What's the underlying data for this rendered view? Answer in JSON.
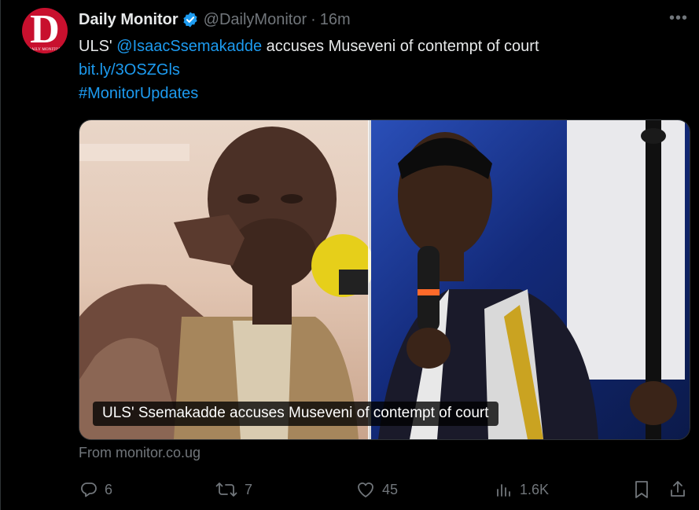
{
  "account": {
    "name": "Daily Monitor",
    "handle": "@DailyMonitor",
    "separator": "·",
    "time": "16m",
    "avatar_logo_letter": "D",
    "avatar_logo_sub": "DAILY MONITOR"
  },
  "more_icon": "…",
  "tweet": {
    "prefix": "ULS' ",
    "mention": "@IsaacSsemakadde",
    "rest": " accuses Museveni of contempt of court",
    "short_link": "bit.ly/3OSZGls",
    "hashtag": "#MonitorUpdates"
  },
  "card": {
    "caption": "ULS' Ssemakadde accuses Museveni of contempt of court",
    "source": "From monitor.co.ug"
  },
  "actions": {
    "replies": "6",
    "reposts": "7",
    "likes": "45",
    "views": "1.6K"
  },
  "colors": {
    "background": "#000000",
    "text": "#e7e9ea",
    "muted": "#71767b",
    "link": "#1d9bf0",
    "verified": "#1d9bf0",
    "brand_red": "#c8102e"
  }
}
